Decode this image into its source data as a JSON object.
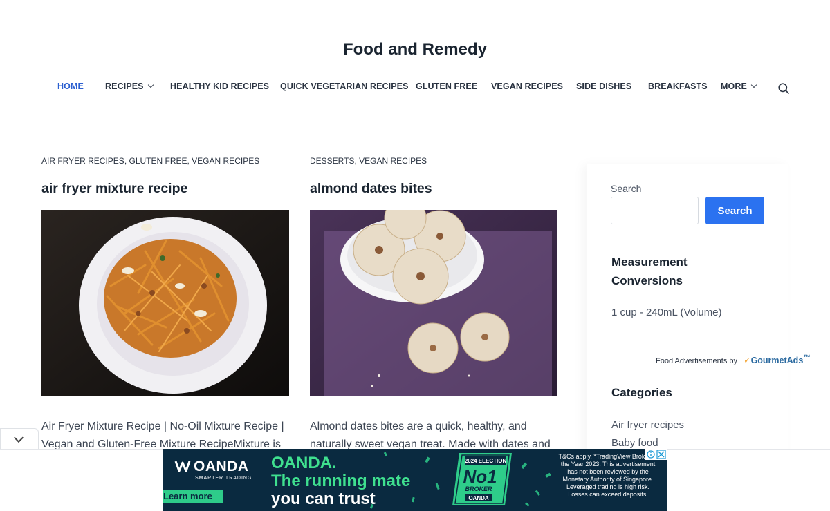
{
  "site": {
    "title": "Food and Remedy"
  },
  "nav": {
    "items": [
      {
        "label": "HOME",
        "active": true
      },
      {
        "label": "RECIPES",
        "dropdown": true
      },
      {
        "label": "HEALTHY KID RECIPES"
      },
      {
        "label": "QUICK VEGETARIAN RECIPES"
      },
      {
        "label": "GLUTEN FREE"
      },
      {
        "label": "VEGAN RECIPES"
      },
      {
        "label": "SIDE DISHES"
      },
      {
        "label": "BREAKFASTS"
      },
      {
        "label": "MORE",
        "dropdown": true
      }
    ],
    "search_icon": "search-icon",
    "active_color": "#2b5fd0"
  },
  "posts": [
    {
      "categories": [
        "AIR FRYER RECIPES",
        "GLUTEN FREE",
        "VEGAN RECIPES"
      ],
      "title": "air fryer mixture recipe",
      "excerpt": "Air Fryer Mixture Recipe | No-Oil Mixture Recipe | Vegan and Gluten-Free Mixture RecipeMixture is"
    },
    {
      "categories": [
        "DESSERTS",
        "VEGAN RECIPES"
      ],
      "title": "almond dates bites",
      "excerpt": "Almond dates bites are a quick, healthy, and naturally sweet vegan treat. Made with dates and"
    }
  ],
  "sidebar": {
    "search_label": "Search",
    "search_button": "Search",
    "search_value": "",
    "measurement_heading_1": "Measurement",
    "measurement_heading_2": "Conversions",
    "measurement_item": "1 cup - 240mL (Volume)",
    "categories_heading": "Categories",
    "categories": [
      "Air fryer recipes",
      "Baby food"
    ],
    "button_color": "#2b72f0"
  },
  "gourmet_ad": {
    "text": "Food Advertisements by",
    "brand": "GourmetAds",
    "brand_tm": "™"
  },
  "banner_ad": {
    "brand": "OANDA",
    "tagline": "SMARTER TRADING",
    "learn_more": "Learn more",
    "headline_1": "OANDA.",
    "headline_2": "The running mate",
    "headline_3": "you can trust",
    "badge_year": "2024 ELECTION",
    "badge_no": "No1",
    "badge_word": "BROKER",
    "badge_brand": "OANDA",
    "disclaimer": "T&Cs apply. *TradingView Broker of the Year 2023. This advertisement has not been reviewed by the Monetary Authority of Singapore. Leveraged trading is high risk. Losses can exceed deposits.",
    "accent": "#3fe08f",
    "background": "#0a2a40"
  }
}
